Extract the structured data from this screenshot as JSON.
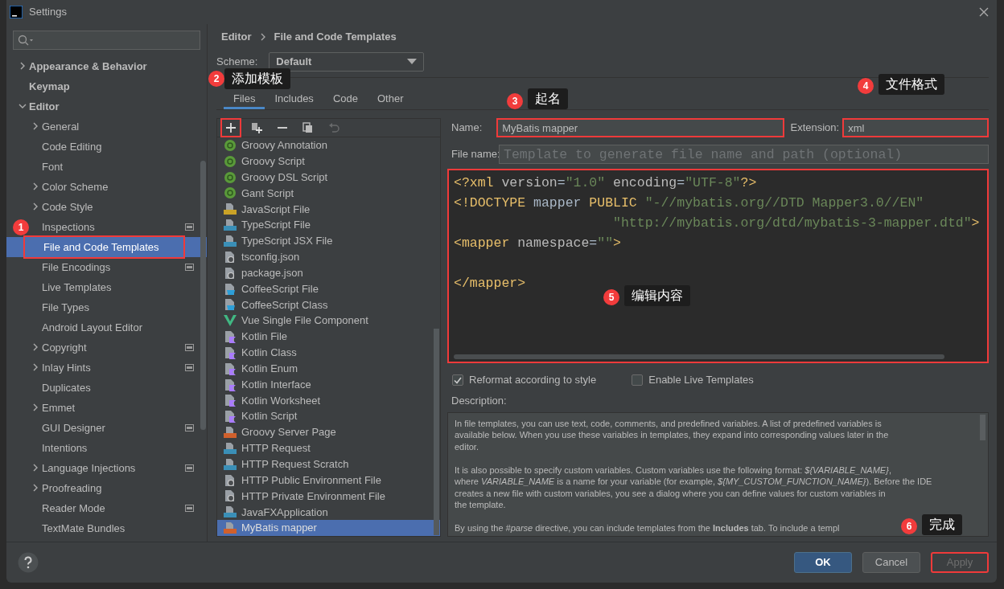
{
  "window": {
    "title": "Settings"
  },
  "sidebar": {
    "items": [
      {
        "label": "Appearance & Behavior",
        "expanded": false
      },
      {
        "label": "Keymap"
      },
      {
        "label": "Editor",
        "expanded": true,
        "children": [
          {
            "label": "General",
            "expanded": false
          },
          {
            "label": "Code Editing"
          },
          {
            "label": "Font"
          },
          {
            "label": "Color Scheme",
            "expanded": false
          },
          {
            "label": "Code Style",
            "expanded": false
          },
          {
            "label": "Inspections",
            "project_scope": true
          },
          {
            "label": "File and Code Templates",
            "selected": true,
            "highlighted": true
          },
          {
            "label": "File Encodings",
            "project_scope": true
          },
          {
            "label": "Live Templates"
          },
          {
            "label": "File Types"
          },
          {
            "label": "Android Layout Editor"
          },
          {
            "label": "Copyright",
            "expanded": false,
            "project_scope": true
          },
          {
            "label": "Inlay Hints",
            "expanded": false,
            "project_scope": true
          },
          {
            "label": "Duplicates"
          },
          {
            "label": "Emmet",
            "expanded": false
          },
          {
            "label": "GUI Designer",
            "project_scope": true
          },
          {
            "label": "Intentions"
          },
          {
            "label": "Language Injections",
            "expanded": false,
            "project_scope": true
          },
          {
            "label": "Proofreading",
            "expanded": false
          },
          {
            "label": "Reader Mode",
            "project_scope": true
          },
          {
            "label": "TextMate Bundles"
          }
        ]
      }
    ]
  },
  "breadcrumb": [
    "Editor",
    "File and Code Templates"
  ],
  "scheme": {
    "label": "Scheme:",
    "value": "Default"
  },
  "tabs": [
    {
      "label": "Files",
      "selected": true
    },
    {
      "label": "Includes",
      "selected": false
    },
    {
      "label": "Code",
      "selected": false
    },
    {
      "label": "Other",
      "selected": false
    }
  ],
  "toolbar": [
    {
      "kind": "add",
      "disabled": false,
      "highlighted": true
    },
    {
      "kind": "add-child",
      "disabled": false
    },
    {
      "kind": "remove",
      "disabled": false
    },
    {
      "kind": "copy",
      "disabled": false
    },
    {
      "kind": "reset",
      "disabled": true
    }
  ],
  "templates": [
    {
      "label": "Groovy Annotation",
      "kind": "groovy",
      "selected": false
    },
    {
      "label": "Groovy Script",
      "kind": "groovy",
      "selected": false
    },
    {
      "label": "Groovy DSL Script",
      "kind": "groovy",
      "selected": false
    },
    {
      "label": "Gant Script",
      "kind": "groovy",
      "selected": false
    },
    {
      "label": "JavaScript File",
      "kind": "file",
      "color": "#c9a227",
      "selected": false
    },
    {
      "label": "TypeScript File",
      "kind": "file",
      "color": "#3a8fb7",
      "selected": false
    },
    {
      "label": "TypeScript JSX File",
      "kind": "file",
      "color": "#3a8fb7",
      "selected": false
    },
    {
      "label": "tsconfig.json",
      "kind": "config",
      "selected": false
    },
    {
      "label": "package.json",
      "kind": "config",
      "selected": false
    },
    {
      "label": "CoffeeScript File",
      "kind": "coffee",
      "selected": false
    },
    {
      "label": "CoffeeScript Class",
      "kind": "coffee",
      "selected": false
    },
    {
      "label": "Vue Single File Component",
      "kind": "vue",
      "selected": false
    },
    {
      "label": "Kotlin File",
      "kind": "kotlin",
      "selected": false
    },
    {
      "label": "Kotlin Class",
      "kind": "kotlin",
      "selected": false
    },
    {
      "label": "Kotlin Enum",
      "kind": "kotlin",
      "selected": false
    },
    {
      "label": "Kotlin Interface",
      "kind": "kotlin",
      "selected": false
    },
    {
      "label": "Kotlin Worksheet",
      "kind": "kotlin",
      "selected": false
    },
    {
      "label": "Kotlin Script",
      "kind": "kotlin",
      "selected": false
    },
    {
      "label": "Groovy Server Page",
      "kind": "file",
      "color": "#d0602c",
      "selected": false
    },
    {
      "label": "HTTP Request",
      "kind": "file",
      "color": "#3a8fb7",
      "selected": false
    },
    {
      "label": "HTTP Request Scratch",
      "kind": "file",
      "color": "#3a8fb7",
      "selected": false
    },
    {
      "label": "HTTP Public Environment File",
      "kind": "config",
      "selected": false
    },
    {
      "label": "HTTP Private Environment File",
      "kind": "config",
      "selected": false
    },
    {
      "label": "JavaFXApplication",
      "kind": "file",
      "color": "#3a8fb7",
      "selected": false
    },
    {
      "label": "MyBatis mapper",
      "kind": "file",
      "color": "#d0602c",
      "selected": true
    }
  ],
  "form": {
    "name": {
      "label": "Name:",
      "value": "MyBatis mapper",
      "highlighted": true
    },
    "extension": {
      "label": "Extension:",
      "value": "xml",
      "highlighted": true
    },
    "file_name": {
      "label": "File name:",
      "placeholder": "Template to generate file name and path (optional)"
    }
  },
  "editor": {
    "highlighted": true,
    "lines": [
      {
        "tokens": [
          {
            "text": "<?xml ",
            "kind": "tag"
          },
          {
            "text": "version",
            "kind": "attr"
          },
          {
            "text": "=",
            "kind": "plain"
          },
          {
            "text": "\"1.0\"",
            "kind": "string"
          },
          {
            "text": " encoding",
            "kind": "attr"
          },
          {
            "text": "=",
            "kind": "plain"
          },
          {
            "text": "\"UTF-8\"",
            "kind": "string"
          },
          {
            "text": "?>",
            "kind": "tag"
          }
        ]
      },
      {
        "tokens": [
          {
            "text": "<!DOCTYPE",
            "kind": "tag"
          },
          {
            "text": " mapper ",
            "kind": "plain"
          },
          {
            "text": "PUBLIC ",
            "kind": "tag"
          },
          {
            "text": "\"-//mybatis.org//DTD Mapper3.0//EN\"",
            "kind": "string"
          }
        ]
      },
      {
        "tokens": [
          {
            "text": "                    \"http://mybatis.org/dtd/mybatis-3-mapper.dtd\"",
            "kind": "string"
          },
          {
            "text": ">",
            "kind": "tag"
          }
        ]
      },
      {
        "tokens": [
          {
            "text": "<mapper ",
            "kind": "tag"
          },
          {
            "text": "namespace",
            "kind": "attr"
          },
          {
            "text": "=",
            "kind": "plain"
          },
          {
            "text": "\"\"",
            "kind": "string"
          },
          {
            "text": ">",
            "kind": "tag"
          }
        ]
      },
      {
        "gap_before": true,
        "tokens": [
          {
            "text": "</mapper>",
            "kind": "tag"
          }
        ]
      }
    ]
  },
  "options": [
    {
      "label": "Reformat according to style",
      "checked": true
    },
    {
      "label": "Enable Live Templates",
      "checked": false
    }
  ],
  "description": {
    "label": "Description:",
    "paragraphs": [
      [
        "In file templates, you can use text, code, comments, and predefined variables. A list of predefined variables is",
        "available below. When you use these variables in templates, they expand into corresponding values later in the",
        "editor."
      ],
      [
        "It is also possible to specify custom variables. Custom variables use the following format: *${VARIABLE_NAME}*,",
        "where *VARIABLE_NAME* is a name for your variable (for example, *${MY_CUSTOM_FUNCTION_NAME}*). Before the IDE",
        "creates a new file with custom variables, you see a dialog where you can define values for custom variables in",
        "the template."
      ],
      [
        "By using the *#parse* directive, you can include templates from the **Includes** tab. To include a templ"
      ]
    ]
  },
  "buttons": [
    {
      "label": "OK",
      "kind": "primary",
      "disabled": false
    },
    {
      "label": "Cancel",
      "kind": "secondary",
      "disabled": false
    },
    {
      "label": "Apply",
      "kind": "secondary",
      "disabled": true,
      "highlighted": true
    }
  ],
  "annotations": [
    {
      "number": "1"
    },
    {
      "number": "2",
      "label": "添加模板"
    },
    {
      "number": "3",
      "label": "起名"
    },
    {
      "number": "4",
      "label": "文件格式"
    },
    {
      "number": "5",
      "label": "编辑内容"
    },
    {
      "number": "6",
      "label": "完成"
    }
  ]
}
